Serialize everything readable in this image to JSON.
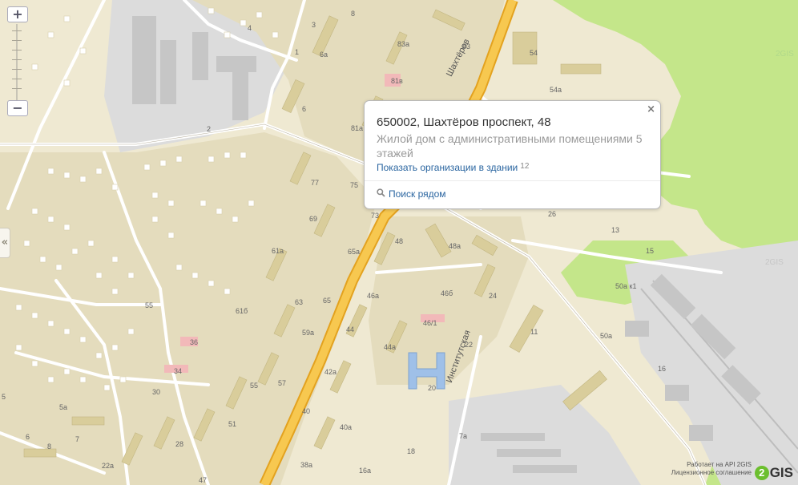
{
  "map": {
    "house_numbers": [
      "8",
      "4",
      "3",
      "1",
      "6а",
      "83а",
      "83",
      "81в",
      "6",
      "81а",
      "2",
      "54",
      "54а",
      "77",
      "75",
      "73",
      "69",
      "48",
      "48а",
      "61а",
      "65а",
      "46а",
      "46б",
      "55",
      "63",
      "65",
      "61б",
      "44",
      "46/1",
      "59а",
      "36",
      "44а",
      "22",
      "42а",
      "20",
      "34",
      "57",
      "55",
      "30",
      "40",
      "40а",
      "51",
      "28",
      "5а",
      "7",
      "8",
      "6",
      "5",
      "22а",
      "47",
      "38а",
      "16а",
      "18",
      "7а",
      "24",
      "11",
      "50а",
      "50а к1",
      "16",
      "13",
      "15",
      "26"
    ],
    "street_labels": [
      "Шахтёров",
      "Институтская"
    ],
    "watermark": "2GIS",
    "colors": {
      "background": "#efe9d2",
      "blocks": "#e4dcbd",
      "buildings": "#d9cd9b",
      "major_road": "#f2b736",
      "road": "#ffffff",
      "park": "#c4e68a",
      "industrial": "#d9d9d9"
    }
  },
  "zoom": {
    "plus_label": "+",
    "minus_label": "−",
    "plus_icon": "plus-icon",
    "minus_icon": "minus-icon"
  },
  "sidebar": {
    "toggle_label": "«"
  },
  "popup": {
    "close_label": "×",
    "address": "650002, Шахтёров проспект, 48",
    "description": "Жилой дом с административными помещениями 5 этажей",
    "orgs_link": "Показать организации в здании",
    "orgs_count": "12",
    "nearby_link": "Поиск рядом",
    "nearby_icon": "magnifier-icon"
  },
  "footer": {
    "api_credit": "Работает на API 2GIS",
    "license": "Лицензионное соглашение",
    "logo_text": "GIS",
    "logo_digit": "2"
  }
}
